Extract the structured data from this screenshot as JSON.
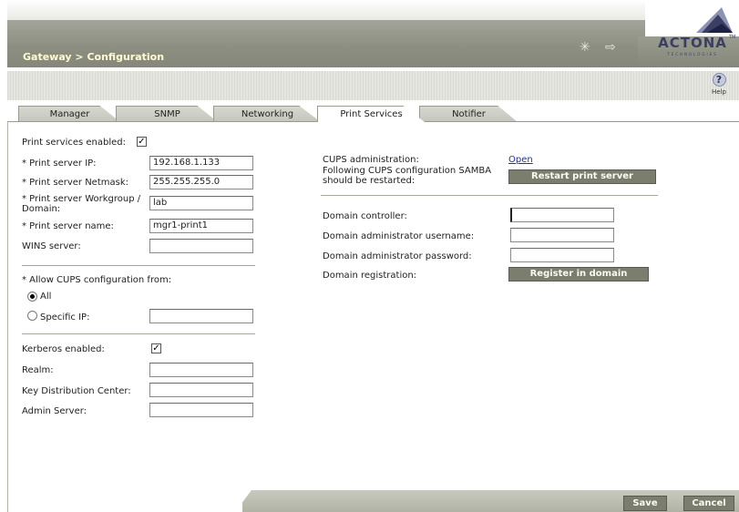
{
  "header": {
    "breadcrumb": "Gateway > Configuration",
    "logo_text": "ACTONA",
    "logo_sub": "TECHNOLOGIES",
    "logo_tm": "TM"
  },
  "toolbar": {
    "help_label": "Help",
    "help_glyph": "?"
  },
  "tabs": [
    {
      "label": "Manager",
      "active": false
    },
    {
      "label": "SNMP",
      "active": false
    },
    {
      "label": "Networking",
      "active": false
    },
    {
      "label": "Print Services",
      "active": true
    },
    {
      "label": "Notifier",
      "active": false
    }
  ],
  "left": {
    "print_enabled_label": "Print services enabled:",
    "print_enabled": true,
    "server_ip_label": "* Print server IP:",
    "server_ip_value": "192.168.1.133",
    "netmask_label": "* Print server Netmask:",
    "netmask_value": "255.255.255.0",
    "workgroup_label": "* Print server Workgroup / Domain:",
    "workgroup_value": "lab",
    "server_name_label": "* Print server name:",
    "server_name_value": "mgr1-print1",
    "wins_label": "WINS server:",
    "wins_value": "",
    "cups_from_label": "* Allow CUPS configuration from:",
    "cups_all_label": "All",
    "cups_specific_label": "Specific IP:",
    "cups_specific_value": "",
    "kerberos_label": "Kerberos enabled:",
    "kerberos_enabled": true,
    "realm_label": "Realm:",
    "realm_value": "",
    "kdc_label": "Key Distribution Center:",
    "kdc_value": "",
    "admin_server_label": "Admin Server:",
    "admin_server_value": ""
  },
  "right": {
    "cups_admin_label": "CUPS administration:",
    "cups_admin_link": "Open",
    "restart_note": "Following CUPS configuration SAMBA should be restarted:",
    "restart_button": "Restart print server",
    "domain_controller_label": "Domain controller:",
    "domain_controller_value": "",
    "domain_admin_user_label": "Domain administrator username:",
    "domain_admin_user_value": "",
    "domain_admin_pass_label": "Domain administrator password:",
    "domain_admin_pass_value": "",
    "domain_registration_label": "Domain registration:",
    "register_button": "Register in domain"
  },
  "footer": {
    "save_label": "Save",
    "cancel_label": "Cancel"
  },
  "colors": {
    "button": "#7b7d6e",
    "header": "#8d8f83",
    "link": "#1c2fbf"
  }
}
